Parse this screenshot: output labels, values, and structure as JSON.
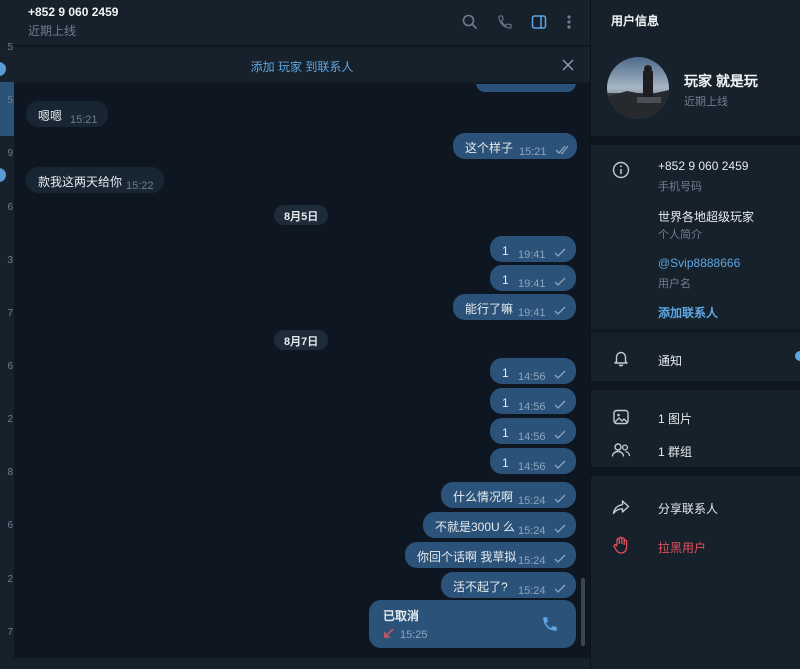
{
  "sidebar_strip": {
    "rows": [
      "5",
      "5",
      "9",
      "6",
      "3",
      "7",
      "6",
      "2",
      "8",
      "6",
      "2",
      "7"
    ]
  },
  "header": {
    "title": "+852 9 060 2459",
    "status": "近期上线",
    "icons": [
      "search-icon",
      "phone-icon",
      "sidebar-toggle-icon",
      "more-icon"
    ]
  },
  "add_contact_bar": {
    "text": "添加 玩家 到联系人",
    "close_icon": "close-icon"
  },
  "messages": [
    {
      "dir": "in",
      "text": "嗯嗯",
      "time": "15:21"
    },
    {
      "dir": "out",
      "text": "这个样子",
      "time": "15:21",
      "read": true
    },
    {
      "dir": "in",
      "text": "款我这两天给你",
      "time": "15:22"
    },
    {
      "date": "8月5日"
    },
    {
      "dir": "out",
      "text": "1",
      "time": "19:41"
    },
    {
      "dir": "out",
      "text": "1",
      "time": "19:41"
    },
    {
      "dir": "out",
      "text": "能行了嘛",
      "time": "19:41"
    },
    {
      "date": "8月7日"
    },
    {
      "dir": "out",
      "text": "1",
      "time": "14:56"
    },
    {
      "dir": "out",
      "text": "1",
      "time": "14:56"
    },
    {
      "dir": "out",
      "text": "1",
      "time": "14:56"
    },
    {
      "dir": "out",
      "text": "1",
      "time": "14:56"
    },
    {
      "dir": "out",
      "text": "什么情况啊",
      "time": "15:24"
    },
    {
      "dir": "out",
      "text": "不就是300U 么",
      "time": "15:24"
    },
    {
      "dir": "out",
      "text": "你回个话啊 我草拟",
      "time": "15:24"
    },
    {
      "dir": "out",
      "text": "活不起了?",
      "time": "15:24"
    },
    {
      "dir": "out",
      "call": true,
      "text": "已取消",
      "time": "15:25"
    }
  ],
  "right_panel": {
    "title": "用户信息",
    "name": "玩家 就是玩",
    "status": "近期上线",
    "phone": "+852 9 060 2459",
    "phone_label": "手机号码",
    "bio": "世界各地超级玩家",
    "bio_label": "个人简介",
    "username": "@Svip8888666",
    "username_label": "用户名",
    "add_contact": "添加联系人",
    "notifications": "通知",
    "photos": "1 图片",
    "groups": "1 群组",
    "share": "分享联系人",
    "block": "拉黑用户"
  },
  "colors": {
    "accent": "#5ea6e3",
    "outgoing_bubble": "#2b5278",
    "incoming_bubble": "#182533",
    "danger": "#e2515a"
  }
}
